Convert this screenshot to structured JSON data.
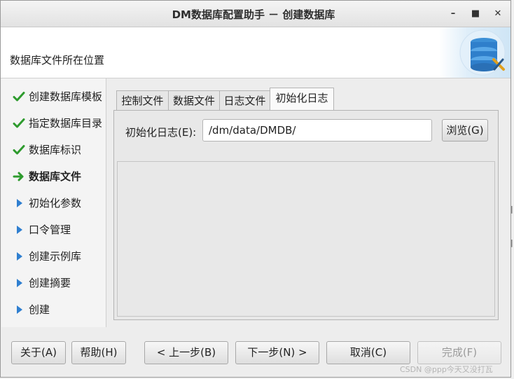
{
  "window": {
    "title": "DM数据库配置助手 － 创建数据库"
  },
  "header": {
    "text": "数据库文件所在位置"
  },
  "nav": {
    "items": [
      {
        "label": "创建数据库模板",
        "status": "done"
      },
      {
        "label": "指定数据库目录",
        "status": "done"
      },
      {
        "label": "数据库标识",
        "status": "done"
      },
      {
        "label": "数据库文件",
        "status": "current"
      },
      {
        "label": "初始化参数",
        "status": "pending"
      },
      {
        "label": "口令管理",
        "status": "pending"
      },
      {
        "label": "创建示例库",
        "status": "pending"
      },
      {
        "label": "创建摘要",
        "status": "pending"
      },
      {
        "label": "创建",
        "status": "pending"
      }
    ]
  },
  "tabs": [
    {
      "label": "控制文件"
    },
    {
      "label": "数据文件"
    },
    {
      "label": "日志文件"
    },
    {
      "label": "初始化日志",
      "active": true
    }
  ],
  "form": {
    "label": "初始化日志(E):",
    "value": "/dm/data/DMDB/",
    "browse_label": "浏览(G)"
  },
  "footer": {
    "about": "关于(A)",
    "help": "帮助(H)",
    "back": "< 上一步(B)",
    "next": "下一步(N) >",
    "cancel": "取消(C)",
    "finish": "完成(F)"
  },
  "watermark": "CSDN @ppp今天又没打瓦",
  "colors": {
    "check": "#2e9b2e",
    "arrow_current": "#2e9b2e",
    "arrow_pending": "#2f7fd0"
  }
}
